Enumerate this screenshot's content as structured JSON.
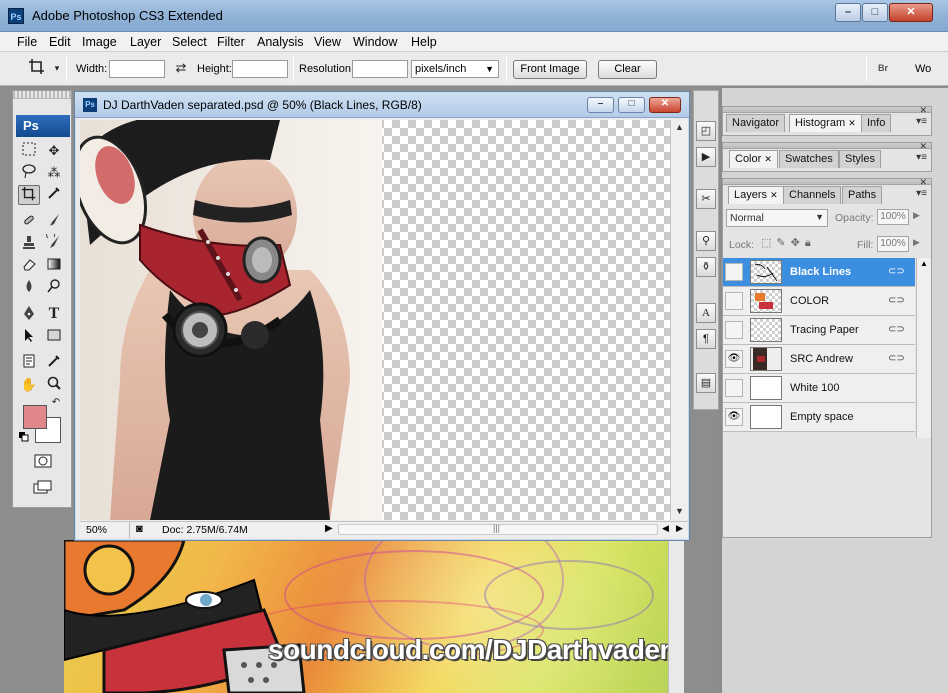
{
  "window": {
    "title": "Adobe Photoshop CS3 Extended",
    "logo_text": "Ps",
    "controls": {
      "minimize": "–",
      "maximize": "□",
      "close": "✕"
    }
  },
  "menu": [
    "File",
    "Edit",
    "Image",
    "Layer",
    "Select",
    "Filter",
    "Analysis",
    "View",
    "Window",
    "Help"
  ],
  "options_bar": {
    "width_label": "Width:",
    "height_label": "Height:",
    "resolution_label": "Resolution:",
    "units": "pixels/inch",
    "front_image_button": "Front Image",
    "clear_button": "Clear",
    "workspace_label": "Wo"
  },
  "tools": {
    "logo": "Ps",
    "foreground_color": "#e0878c",
    "background_color": "#ffffff"
  },
  "document": {
    "title": "DJ DarthVaden separated.psd @ 50% (Black Lines, RGB/8)",
    "icon_text": "Ps",
    "zoom": "50%",
    "doc_info": "Doc: 2.75M/6.74M"
  },
  "background_document": {
    "caption": "soundcloud.com/DJDarthvaden"
  },
  "panels": {
    "group1_tabs": [
      "Navigator",
      "Histogram",
      "Info"
    ],
    "group2_tabs": [
      "Color",
      "Swatches",
      "Styles"
    ],
    "group3_tabs": [
      "Layers",
      "Channels",
      "Paths"
    ],
    "blend_mode": "Normal",
    "opacity_label": "Opacity:",
    "opacity_value": "100%",
    "lock_label": "Lock:",
    "fill_label": "Fill:",
    "fill_value": "100%",
    "layers": [
      {
        "name": "Black Lines",
        "visible": false,
        "selected": true,
        "linked": true,
        "thumb": "lines"
      },
      {
        "name": "COLOR",
        "visible": false,
        "selected": false,
        "linked": true,
        "thumb": "color"
      },
      {
        "name": "Tracing Paper",
        "visible": false,
        "selected": false,
        "linked": true,
        "thumb": "checker"
      },
      {
        "name": "SRC Andrew",
        "visible": true,
        "selected": false,
        "linked": true,
        "thumb": "photo"
      },
      {
        "name": "White 100",
        "visible": false,
        "selected": false,
        "linked": false,
        "thumb": "white"
      },
      {
        "name": "Empty space",
        "visible": true,
        "selected": false,
        "linked": false,
        "thumb": "white"
      }
    ]
  },
  "colors": {
    "selected_layer": "#3c8ee0",
    "title_bar": "#8fb1d6"
  }
}
